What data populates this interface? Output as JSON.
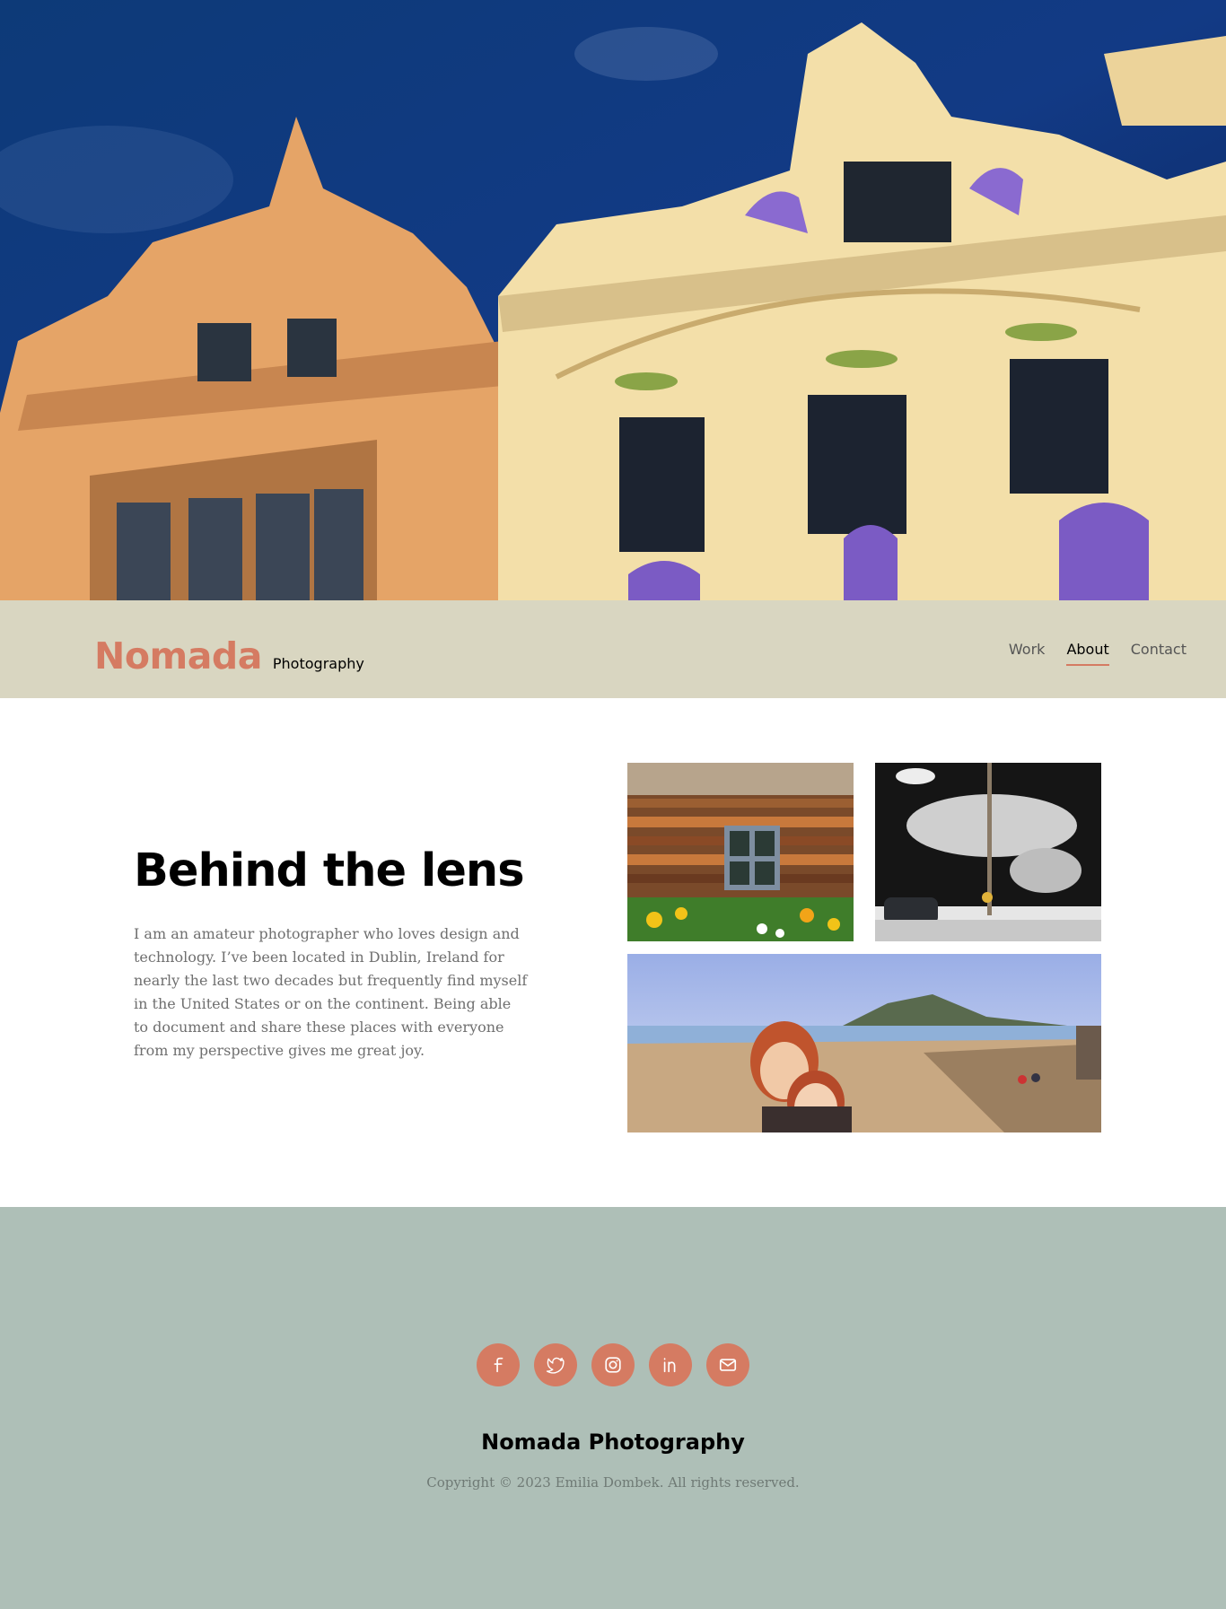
{
  "colors": {
    "accent": "#d57b62",
    "header_bg": "#d9d6c1",
    "footer_bg": "#aebfb7"
  },
  "header": {
    "brand_name": "Nomada",
    "brand_sub": "Photography",
    "nav": [
      {
        "label": "Work",
        "active": false
      },
      {
        "label": "About",
        "active": true
      },
      {
        "label": "Contact",
        "active": false
      }
    ]
  },
  "about": {
    "title": "Behind the lens",
    "body": "I am an amateur photographer who loves design and technology. I’ve been located in Dublin, Ireland for nearly the last two decades but frequently find myself in the United States or on the continent. Being able to document and share these places with everyone from my perspective gives me great joy."
  },
  "footer": {
    "socials": [
      "facebook-icon",
      "twitter-icon",
      "instagram-icon",
      "linkedin-icon",
      "mail-icon"
    ],
    "title": "Nomada Photography",
    "copyright": "Copyright © 2023 Emilia Dombek. All rights reserved."
  }
}
